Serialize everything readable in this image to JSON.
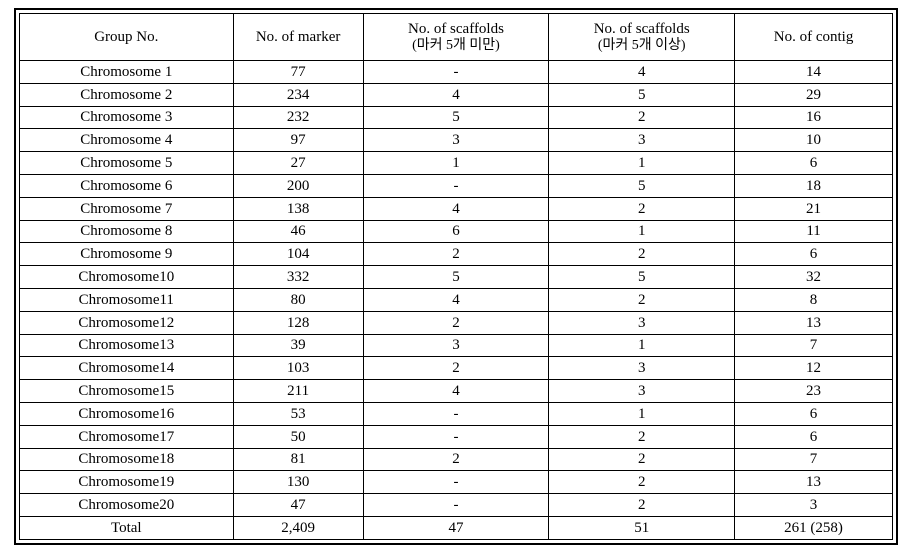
{
  "headers": {
    "group_no": "Group No.",
    "no_marker": "No. of\nmarker",
    "scaffolds_lt5_line1": "No. of scaffolds",
    "scaffolds_lt5_line2": "(마커 5개 미만)",
    "scaffolds_ge5_line1": "No. of scaffolds",
    "scaffolds_ge5_line2": "(마커 5개 이상)",
    "no_contig": "No. of contig"
  },
  "rows": [
    {
      "group": "Chromosome 1",
      "marker": "77",
      "sc_lt5": "-",
      "sc_ge5": "4",
      "contig": "14"
    },
    {
      "group": "Chromosome 2",
      "marker": "234",
      "sc_lt5": "4",
      "sc_ge5": "5",
      "contig": "29"
    },
    {
      "group": "Chromosome 3",
      "marker": "232",
      "sc_lt5": "5",
      "sc_ge5": "2",
      "contig": "16"
    },
    {
      "group": "Chromosome 4",
      "marker": "97",
      "sc_lt5": "3",
      "sc_ge5": "3",
      "contig": "10"
    },
    {
      "group": "Chromosome 5",
      "marker": "27",
      "sc_lt5": "1",
      "sc_ge5": "1",
      "contig": "6"
    },
    {
      "group": "Chromosome 6",
      "marker": "200",
      "sc_lt5": "-",
      "sc_ge5": "5",
      "contig": "18"
    },
    {
      "group": "Chromosome 7",
      "marker": "138",
      "sc_lt5": "4",
      "sc_ge5": "2",
      "contig": "21"
    },
    {
      "group": "Chromosome 8",
      "marker": "46",
      "sc_lt5": "6",
      "sc_ge5": "1",
      "contig": "11"
    },
    {
      "group": "Chromosome 9",
      "marker": "104",
      "sc_lt5": "2",
      "sc_ge5": "2",
      "contig": "6"
    },
    {
      "group": "Chromosome10",
      "marker": "332",
      "sc_lt5": "5",
      "sc_ge5": "5",
      "contig": "32"
    },
    {
      "group": "Chromosome11",
      "marker": "80",
      "sc_lt5": "4",
      "sc_ge5": "2",
      "contig": "8"
    },
    {
      "group": "Chromosome12",
      "marker": "128",
      "sc_lt5": "2",
      "sc_ge5": "3",
      "contig": "13"
    },
    {
      "group": "Chromosome13",
      "marker": "39",
      "sc_lt5": "3",
      "sc_ge5": "1",
      "contig": "7"
    },
    {
      "group": "Chromosome14",
      "marker": "103",
      "sc_lt5": "2",
      "sc_ge5": "3",
      "contig": "12"
    },
    {
      "group": "Chromosome15",
      "marker": "211",
      "sc_lt5": "4",
      "sc_ge5": "3",
      "contig": "23"
    },
    {
      "group": "Chromosome16",
      "marker": "53",
      "sc_lt5": "-",
      "sc_ge5": "1",
      "contig": "6"
    },
    {
      "group": "Chromosome17",
      "marker": "50",
      "sc_lt5": "-",
      "sc_ge5": "2",
      "contig": "6"
    },
    {
      "group": "Chromosome18",
      "marker": "81",
      "sc_lt5": "2",
      "sc_ge5": "2",
      "contig": "7"
    },
    {
      "group": "Chromosome19",
      "marker": "130",
      "sc_lt5": "-",
      "sc_ge5": "2",
      "contig": "13"
    },
    {
      "group": "Chromosome20",
      "marker": "47",
      "sc_lt5": "-",
      "sc_ge5": "2",
      "contig": "3"
    }
  ],
  "total": {
    "label": "Total",
    "marker": "2,409",
    "sc_lt5": "47",
    "sc_ge5": "51",
    "contig": "261 (258)"
  },
  "chart_data": {
    "type": "table",
    "title": "",
    "columns": [
      "Group No.",
      "No. of marker",
      "No. of scaffolds (마커 5개 미만)",
      "No. of scaffolds (마커 5개 이상)",
      "No. of contig"
    ],
    "rows": [
      [
        "Chromosome 1",
        77,
        null,
        4,
        14
      ],
      [
        "Chromosome 2",
        234,
        4,
        5,
        29
      ],
      [
        "Chromosome 3",
        232,
        5,
        2,
        16
      ],
      [
        "Chromosome 4",
        97,
        3,
        3,
        10
      ],
      [
        "Chromosome 5",
        27,
        1,
        1,
        6
      ],
      [
        "Chromosome 6",
        200,
        null,
        5,
        18
      ],
      [
        "Chromosome 7",
        138,
        4,
        2,
        21
      ],
      [
        "Chromosome 8",
        46,
        6,
        1,
        11
      ],
      [
        "Chromosome 9",
        104,
        2,
        2,
        6
      ],
      [
        "Chromosome10",
        332,
        5,
        5,
        32
      ],
      [
        "Chromosome11",
        80,
        4,
        2,
        8
      ],
      [
        "Chromosome12",
        128,
        2,
        3,
        13
      ],
      [
        "Chromosome13",
        39,
        3,
        1,
        7
      ],
      [
        "Chromosome14",
        103,
        2,
        3,
        12
      ],
      [
        "Chromosome15",
        211,
        4,
        3,
        23
      ],
      [
        "Chromosome16",
        53,
        null,
        1,
        6
      ],
      [
        "Chromosome17",
        50,
        null,
        2,
        6
      ],
      [
        "Chromosome18",
        81,
        2,
        2,
        7
      ],
      [
        "Chromosome19",
        130,
        null,
        2,
        13
      ],
      [
        "Chromosome20",
        47,
        null,
        2,
        3
      ],
      [
        "Total",
        2409,
        47,
        51,
        "261 (258)"
      ]
    ]
  }
}
